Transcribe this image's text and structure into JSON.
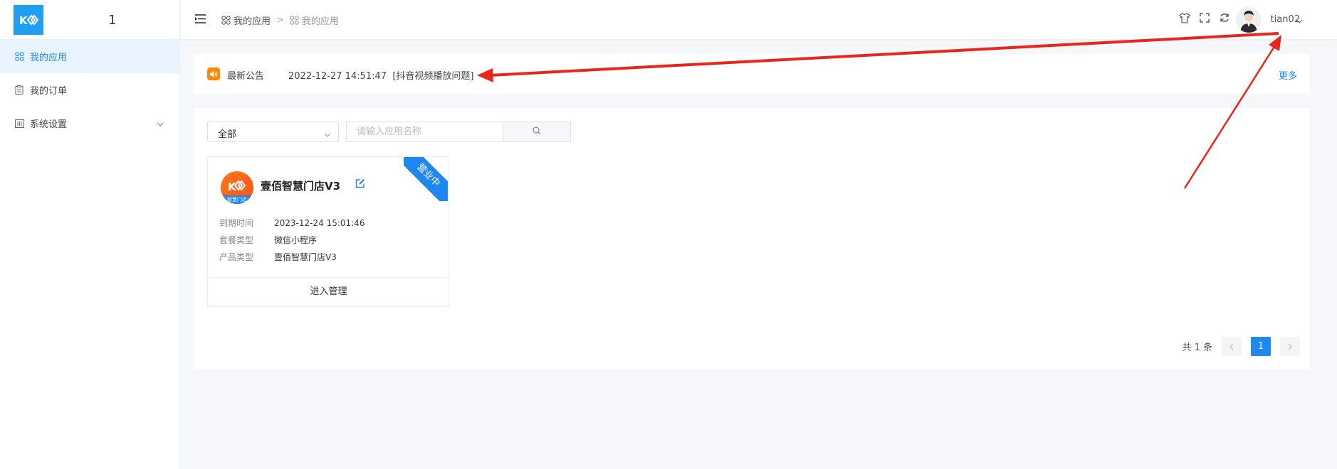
{
  "sidebar": {
    "logo_number": "1",
    "items": [
      {
        "label": "我的应用",
        "icon": "grid-icon",
        "active": true
      },
      {
        "label": "我的订单",
        "icon": "clipboard-icon",
        "active": false
      },
      {
        "label": "系统设置",
        "icon": "settings-panel-icon",
        "active": false
      }
    ]
  },
  "header": {
    "breadcrumb": [
      "我的应用",
      "我的应用"
    ],
    "breadcrumb_separator": ">",
    "tools": [
      "tshirt-icon",
      "fullscreen-icon",
      "refresh-icon"
    ],
    "username": "tian02"
  },
  "notice": {
    "label": "最新公告",
    "text": "2022-12-27 14:51:47  [抖音视频播放问题]",
    "more": "更多"
  },
  "filter": {
    "select_value": "全部",
    "search_placeholder": "请输入应用名称"
  },
  "app_card": {
    "title": "壹佰智慧门店V3",
    "logo_band_text": "智慧门店",
    "ribbon": "营业中",
    "fields": [
      {
        "key": "到期时间",
        "value": "2023-12-24 15:01:46"
      },
      {
        "key": "套餐类型",
        "value": "微信小程序"
      },
      {
        "key": "产品类型",
        "value": "壹佰智慧门店V3"
      }
    ],
    "action": "进入管理"
  },
  "pagination": {
    "total_text": "共 1 条",
    "current_page": "1"
  },
  "colors": {
    "primary": "#1e87f0",
    "notice_icon": "#ff8a00",
    "annotation_arrow": "#e8261e"
  }
}
